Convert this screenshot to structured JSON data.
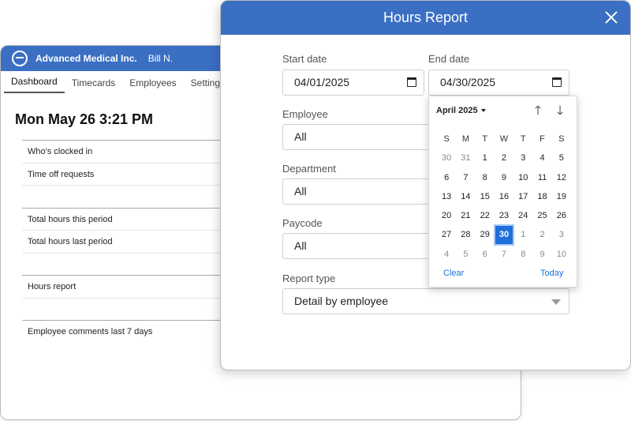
{
  "dashboard": {
    "company": "Advanced Medical Inc.",
    "user": "Bill N.",
    "tabs": [
      "Dashboard",
      "Timecards",
      "Employees",
      "Settings"
    ],
    "datetime": "Mon May 26 3:21 PM",
    "rows": [
      {
        "label": "Who's clocked in"
      },
      {
        "label": "Time off requests"
      },
      {
        "label": ""
      },
      {
        "label": "Total hours this period"
      },
      {
        "label": "Total hours last period"
      },
      {
        "label": ""
      },
      {
        "label": "Hours report"
      },
      {
        "label": ""
      },
      {
        "label": "Employee comments last 7 days"
      }
    ]
  },
  "modal": {
    "title": "Hours Report",
    "start_date": {
      "label": "Start date",
      "value": "04/01/2025"
    },
    "end_date": {
      "label": "End date",
      "value": "04/30/2025"
    },
    "employee": {
      "label": "Employee",
      "value": "All"
    },
    "department": {
      "label": "Department",
      "value": "All"
    },
    "paycode": {
      "label": "Paycode",
      "value": "All"
    },
    "report_type": {
      "label": "Report type",
      "value": "Detail by employee"
    }
  },
  "picker": {
    "month_label": "April 2025",
    "up_arrow": "🡑",
    "down_arrow": "🡓",
    "weekdays": [
      "S",
      "M",
      "T",
      "W",
      "T",
      "F",
      "S"
    ],
    "weeks": [
      [
        "30",
        "31",
        "1",
        "2",
        "3",
        "4",
        "5"
      ],
      [
        "6",
        "7",
        "8",
        "9",
        "10",
        "11",
        "12"
      ],
      [
        "13",
        "14",
        "15",
        "16",
        "17",
        "18",
        "19"
      ],
      [
        "20",
        "21",
        "22",
        "23",
        "24",
        "25",
        "26"
      ],
      [
        "27",
        "28",
        "29",
        "30",
        "1",
        "2",
        "3"
      ],
      [
        "4",
        "5",
        "6",
        "7",
        "8",
        "9",
        "10"
      ]
    ],
    "selected_day": "30",
    "clear_label": "Clear",
    "today_label": "Today"
  },
  "colors": {
    "header": "#3a6fc4",
    "accent": "#1e6fdc"
  }
}
